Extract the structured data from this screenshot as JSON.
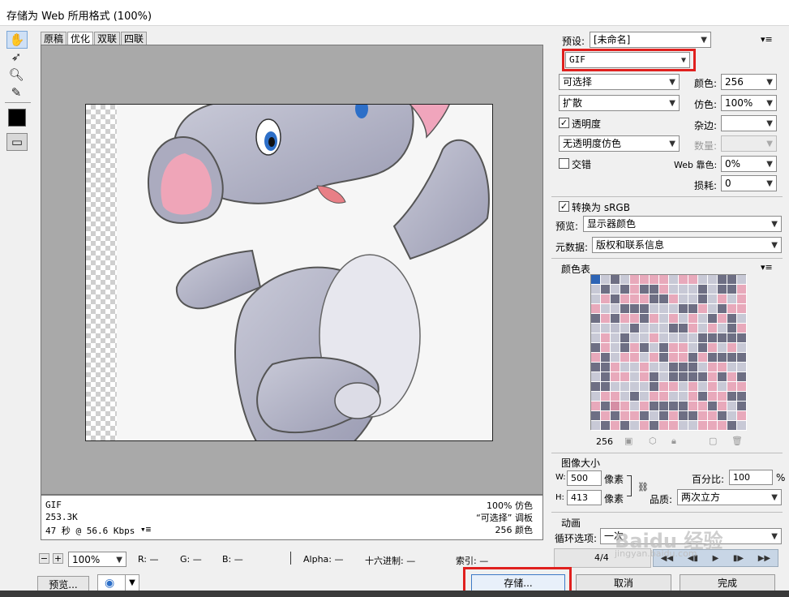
{
  "title": "存储为 Web 所用格式 (100%)",
  "tabs": [
    "原稿",
    "优化",
    "双联",
    "四联"
  ],
  "selected_tab": "优化",
  "info": {
    "format": "GIF",
    "size": "253.3K",
    "speed": "47 秒 @ 56.6 Kbps",
    "dither": "100% 仿色",
    "palette": "“可选择” 调板",
    "colors": "256 颜色"
  },
  "status": {
    "zoom": "100%",
    "r": "R: —",
    "g": "G: —",
    "b": "B: —",
    "alpha": "Alpha: —",
    "hex": "十六进制: —",
    "index": "索引: —"
  },
  "settings": {
    "preset_label": "预设:",
    "preset_value": "[未命名]",
    "format": "GIF",
    "reduction": "可选择",
    "colors_label": "颜色:",
    "colors_value": "256",
    "dither_algo": "扩散",
    "dither_label": "仿色:",
    "dither_value": "100%",
    "transparency_label": "透明度",
    "matte_label": "杂边:",
    "trans_dither": "无透明度仿色",
    "amount_label": "数量:",
    "interlaced_label": "交错",
    "websnap_label": "Web 靠色:",
    "websnap_value": "0%",
    "lossy_label": "损耗:",
    "lossy_value": "0",
    "srgb_label": "转换为 sRGB",
    "preview_label": "预览:",
    "preview_value": "显示器颜色",
    "metadata_label": "元数据:",
    "metadata_value": "版权和联系信息"
  },
  "color_table": {
    "title": "颜色表",
    "count": "256"
  },
  "image_size": {
    "title": "图像大小",
    "w_label": "W:",
    "w_value": "500",
    "h_label": "H:",
    "h_value": "413",
    "unit": "像素",
    "percent_label": "百分比:",
    "percent_value": "100",
    "percent_unit": "%",
    "quality_label": "品质:",
    "quality_value": "两次立方"
  },
  "animation": {
    "title": "动画",
    "loop_label": "循环选项:",
    "loop_value": "一次",
    "frame": "4/4"
  },
  "buttons": {
    "preview": "预览...",
    "save": "存储...",
    "cancel": "取消",
    "done": "完成"
  },
  "watermark": {
    "text": "Baidu 经验",
    "url": "jingyan.baidu.com"
  },
  "colors": {
    "highlight": "#e0201e",
    "canvas_bg": "#a9a9a9"
  }
}
